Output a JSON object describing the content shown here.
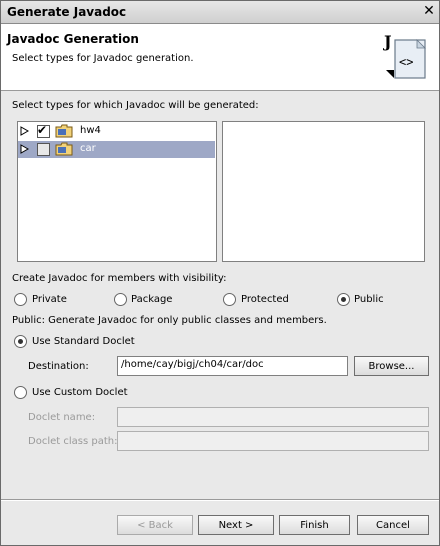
{
  "window": {
    "title": "Generate Javadoc"
  },
  "header": {
    "title": "Javadoc Generation",
    "subtitle": "Select types for Javadoc generation.",
    "icon_letter": "J",
    "icon_tag": "<>"
  },
  "types_section": {
    "label": "Select types for which Javadoc will be generated:",
    "tree": [
      {
        "label": "hw4",
        "checked": true,
        "selected": false
      },
      {
        "label": "car",
        "checked": false,
        "selected": true
      }
    ]
  },
  "visibility": {
    "label": "Create Javadoc for members with visibility:",
    "options": [
      {
        "label": "Private",
        "selected": false
      },
      {
        "label": "Package",
        "selected": false
      },
      {
        "label": "Protected",
        "selected": false
      },
      {
        "label": "Public",
        "selected": true
      }
    ],
    "description": "Public: Generate Javadoc for only public classes and members."
  },
  "standard_doclet": {
    "label": "Use Standard Doclet",
    "selected": true,
    "destination_label": "Destination:",
    "destination_value": "/home/cay/bigj/ch04/car/doc",
    "browse_label": "Browse..."
  },
  "custom_doclet": {
    "label": "Use Custom Doclet",
    "selected": false,
    "doclet_name_label": "Doclet name:",
    "doclet_name_value": "",
    "doclet_classpath_label": "Doclet class path:",
    "doclet_classpath_value": ""
  },
  "buttons": {
    "back": "< Back",
    "next": "Next >",
    "finish": "Finish",
    "cancel": "Cancel"
  },
  "icons": {
    "close": "close-icon",
    "expand": "triangle-right-icon",
    "checkbox": "checkbox-icon",
    "project": "project-folder-icon",
    "banner": "javadoc-wizard-icon"
  }
}
